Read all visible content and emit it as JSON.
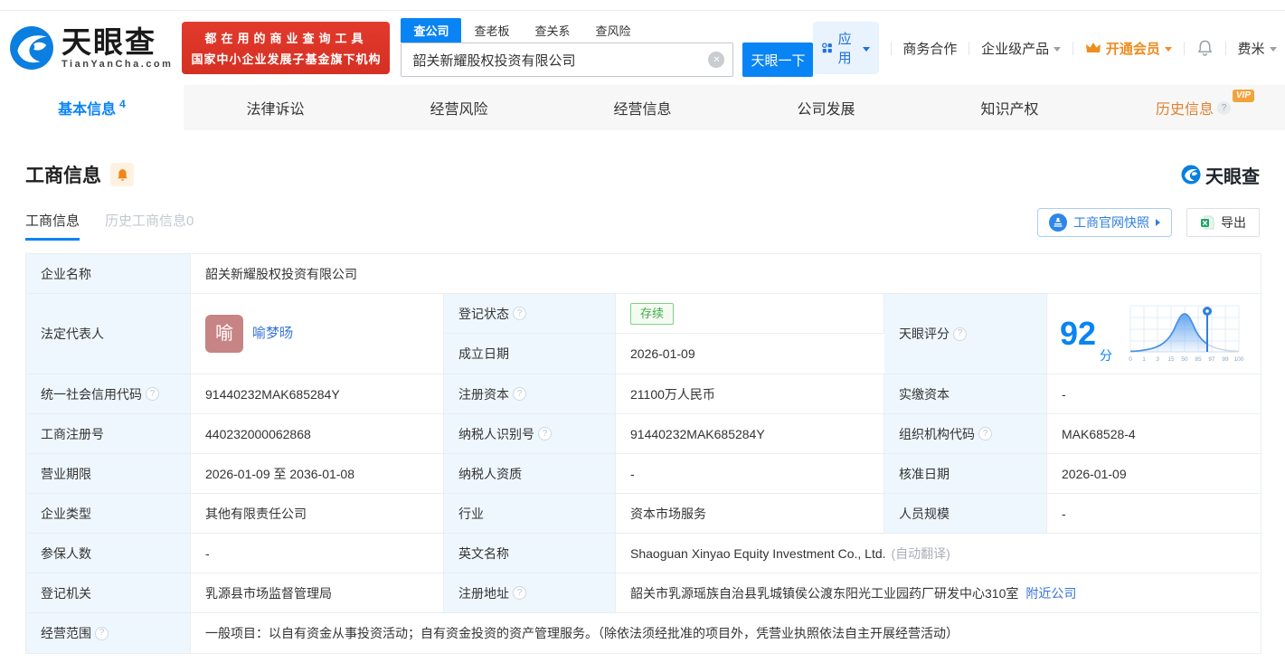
{
  "colors": {
    "accent": "#0984f4",
    "brand_red": "#d93226",
    "vip_orange": "#ef8c1f",
    "status_green": "#42a948",
    "link_blue": "#3672d9",
    "label_bg": "#eef7fd"
  },
  "header": {
    "brand": {
      "name": "天眼查",
      "domain": "TianYanCha.com"
    },
    "banner": {
      "line1": "都在用的商业查询工具",
      "line2": "国家中小企业发展子基金旗下机构"
    },
    "search": {
      "tabs": [
        {
          "label": "查公司"
        },
        {
          "label": "查老板"
        },
        {
          "label": "查关系"
        },
        {
          "label": "查风险"
        }
      ],
      "value": "韶关新耀股权投资有限公司",
      "button": "天眼一下"
    },
    "nav": {
      "apps": "应用",
      "cooperation": "商务合作",
      "enterprise": "企业级产品",
      "vip": "开通会员",
      "user": "费米"
    }
  },
  "tabs": [
    {
      "label": "基本信息",
      "count": "4"
    },
    {
      "label": "法律诉讼"
    },
    {
      "label": "经营风险"
    },
    {
      "label": "经营信息"
    },
    {
      "label": "公司发展"
    },
    {
      "label": "知识产权"
    },
    {
      "label": "历史信息",
      "badge": "VIP"
    }
  ],
  "section": {
    "title": "工商信息",
    "brand": "天眼查",
    "subtabs": [
      {
        "label": "工商信息"
      },
      {
        "label": "历史工商信息0"
      }
    ],
    "snapshot_button": "工商官网快照",
    "export_button": "导出"
  },
  "info": {
    "company": {
      "label": "企业名称",
      "value": "韶关新耀股权投资有限公司"
    },
    "legal": {
      "label": "法定代表人",
      "avatar": "喻",
      "name": "喻梦旸"
    },
    "status": {
      "label": "登记状态",
      "value": "存续"
    },
    "established": {
      "label": "成立日期",
      "value": "2026-01-09"
    },
    "score": {
      "label": "天眼评分",
      "value": "92",
      "unit": "分",
      "axis": [
        "0",
        "1",
        "3",
        "15",
        "50",
        "85",
        "97",
        "99",
        "100"
      ]
    },
    "rows": [
      {
        "l1": "统一社会信用代码",
        "v1": "91440232MAK685284Y",
        "l2": "注册资本",
        "v2": "21100万人民币",
        "l3": "实缴资本",
        "v3": "-"
      },
      {
        "l1": "工商注册号",
        "v1": "440232000062868",
        "l2": "纳税人识别号",
        "v2": "91440232MAK685284Y",
        "l3": "组织机构代码",
        "v3": "MAK68528-4"
      },
      {
        "l1": "营业期限",
        "v1": "2026-01-09 至 2036-01-08",
        "l2": "纳税人资质",
        "v2": "-",
        "l3": "核准日期",
        "v3": "2026-01-09"
      },
      {
        "l1": "企业类型",
        "v1": "其他有限责任公司",
        "l2": "行业",
        "v2": "资本市场服务",
        "l3": "人员规模",
        "v3": "-"
      }
    ],
    "insured": {
      "label": "参保人数",
      "value": "-"
    },
    "english": {
      "label": "英文名称",
      "value": "Shaoguan Xinyao Equity Investment Co., Ltd.",
      "note": "(自动翻译)"
    },
    "authority": {
      "label": "登记机关",
      "value": "乳源县市场监督管理局"
    },
    "address": {
      "label": "注册地址",
      "value": "韶关市乳源瑶族自治县乳城镇侯公渡东阳光工业园药厂研发中心310室",
      "link": "附近公司"
    },
    "scope": {
      "label": "经营范围",
      "value": "一般项目：以自有资金从事投资活动；自有资金投资的资产管理服务。（除依法须经批准的项目外，凭营业执照依法自主开展经营活动）"
    }
  }
}
